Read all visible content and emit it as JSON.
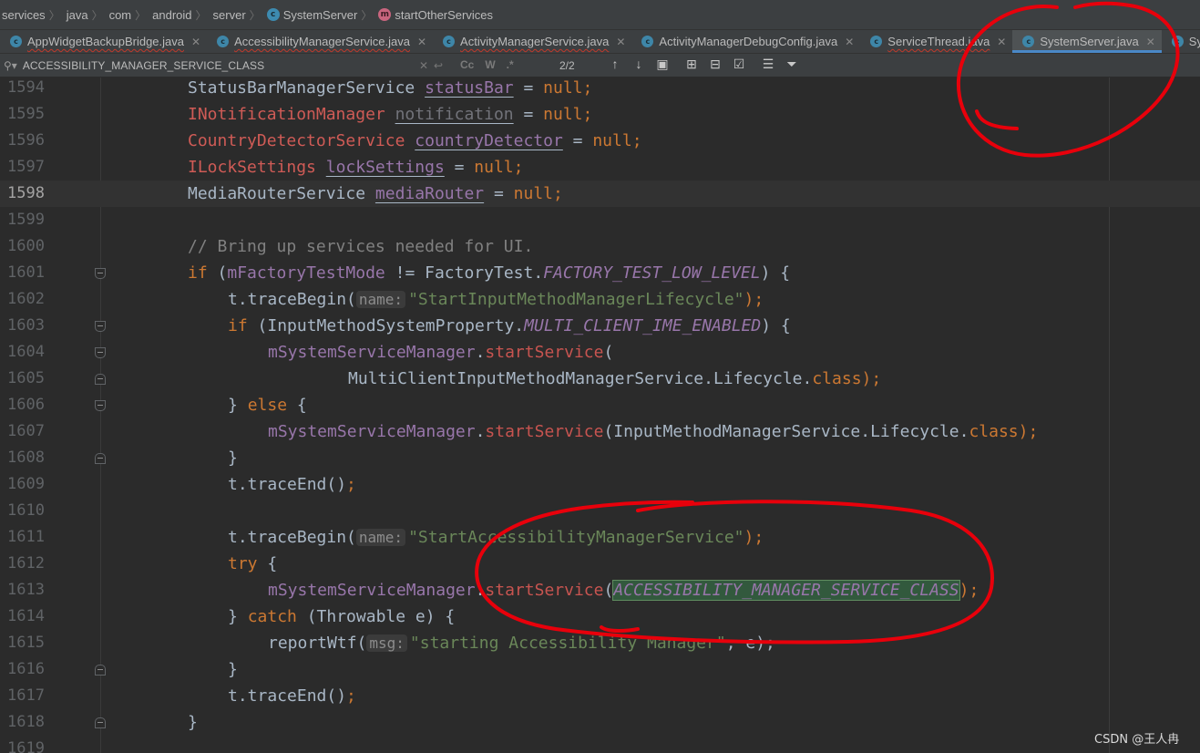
{
  "breadcrumb": [
    {
      "label": "services",
      "icon": ""
    },
    {
      "label": "java",
      "icon": ""
    },
    {
      "label": "com",
      "icon": ""
    },
    {
      "label": "android",
      "icon": ""
    },
    {
      "label": "server",
      "icon": ""
    },
    {
      "label": "SystemServer",
      "icon": "class-icon"
    },
    {
      "label": "startOtherServices",
      "icon": "method-icon"
    }
  ],
  "tabs": [
    {
      "label": "AppWidgetBackupBridge.java",
      "active": false
    },
    {
      "label": "AccessibilityManagerService.java",
      "active": false
    },
    {
      "label": "ActivityManagerService.java",
      "active": false
    },
    {
      "label": "ActivityManagerDebugConfig.java",
      "active": false
    },
    {
      "label": "ServiceThread.java",
      "active": false
    },
    {
      "label": "SystemServer.java",
      "active": true
    },
    {
      "label": "SystemSe",
      "active": false
    }
  ],
  "find": {
    "query": "ACCESSIBILITY_MANAGER_SERVICE_CLASS",
    "options": [
      "Cc",
      "W",
      ".*"
    ],
    "match_count": "2/2"
  },
  "editor": {
    "current_line": 1598,
    "lines": [
      {
        "n": "1594",
        "fold": ""
      },
      {
        "n": "1595",
        "fold": ""
      },
      {
        "n": "1596",
        "fold": ""
      },
      {
        "n": "1597",
        "fold": ""
      },
      {
        "n": "1598",
        "fold": ""
      },
      {
        "n": "1599",
        "fold": ""
      },
      {
        "n": "1600",
        "fold": ""
      },
      {
        "n": "1601",
        "fold": "open"
      },
      {
        "n": "1602",
        "fold": ""
      },
      {
        "n": "1603",
        "fold": "open"
      },
      {
        "n": "1604",
        "fold": "open"
      },
      {
        "n": "1605",
        "fold": "close"
      },
      {
        "n": "1606",
        "fold": "open"
      },
      {
        "n": "1607",
        "fold": ""
      },
      {
        "n": "1608",
        "fold": "close"
      },
      {
        "n": "1609",
        "fold": ""
      },
      {
        "n": "1610",
        "fold": ""
      },
      {
        "n": "1611",
        "fold": ""
      },
      {
        "n": "1612",
        "fold": ""
      },
      {
        "n": "1613",
        "fold": ""
      },
      {
        "n": "1614",
        "fold": ""
      },
      {
        "n": "1615",
        "fold": ""
      },
      {
        "n": "1616",
        "fold": "close"
      },
      {
        "n": "1617",
        "fold": ""
      },
      {
        "n": "1618",
        "fold": "close"
      },
      {
        "n": "1619",
        "fold": ""
      }
    ],
    "code": {
      "l1594": [
        "StatusBarManagerService",
        "statusBar",
        "null"
      ],
      "l1595": [
        "INotificationManager",
        "notification",
        "null"
      ],
      "l1596": [
        "CountryDetectorService",
        "countryDetector",
        "null"
      ],
      "l1597": [
        "ILockSettings",
        "lockSettings",
        "null"
      ],
      "l1598": [
        "MediaRouterService",
        "mediaRouter",
        "null"
      ],
      "l1600": "// Bring up services needed for UI.",
      "l1601": [
        "if",
        "mFactoryTestMode",
        "!= FactoryTest.",
        "FACTORY_TEST_LOW_LEVEL",
        ") {"
      ],
      "l1602": [
        "t.traceBegin(",
        "name:",
        "\"StartInputMethodManagerLifecycle\"",
        ");"
      ],
      "l1603": [
        "if",
        "(InputMethodSystemProperty.",
        "MULTI_CLIENT_IME_ENABLED",
        ") {"
      ],
      "l1604": [
        "mSystemServiceManager",
        ".",
        "startService",
        "("
      ],
      "l1605": [
        "MultiClientInputMethodManagerService.Lifecycle.",
        "class",
        ");"
      ],
      "l1606": [
        "} ",
        "else",
        " {"
      ],
      "l1607": [
        "mSystemServiceManager",
        ".",
        "startService",
        "(InputMethodManagerService.Lifecycle.",
        "class",
        ");"
      ],
      "l1608": "}",
      "l1609": [
        "t.traceEnd()",
        ";"
      ],
      "l1611": [
        "t.traceBegin(",
        "name:",
        "\"StartAccessibilityManagerService\"",
        ");"
      ],
      "l1612": [
        "try",
        " {"
      ],
      "l1613": [
        "mSystemServiceManager",
        ".",
        "startService",
        "(",
        "ACCESSIBILITY_MANAGER_SERVICE_CLASS",
        ");"
      ],
      "l1614": [
        "} ",
        "catch",
        " (Throwable e) {"
      ],
      "l1615": [
        "reportWtf(",
        "msg:",
        "\"starting Accessibility Manager\"",
        ", e);"
      ],
      "l1616": "}",
      "l1617": [
        "t.traceEnd()",
        ";"
      ],
      "l1618": "}"
    }
  },
  "watermark": "CSDN @王人冉",
  "colors": {
    "keyword": "#cc7832",
    "string": "#6a8759",
    "field": "#9876aa",
    "comment": "#808080",
    "annotation_red": "#e8000b"
  }
}
